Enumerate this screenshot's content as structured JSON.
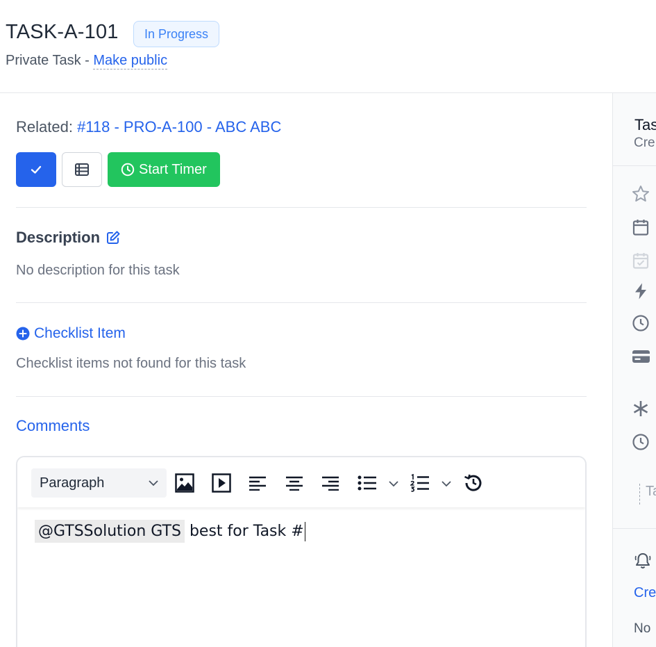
{
  "header": {
    "task_id": "TASK-A-101",
    "status": "In Progress",
    "privacy_label": "Private Task - ",
    "make_public": "Make public"
  },
  "main": {
    "related_label": "Related: ",
    "related_link": "#118 - PRO-A-100 - ABC ABC",
    "actions": {
      "complete_icon": "check-icon",
      "list_icon": "list-icon",
      "timer_icon": "clock-icon",
      "start_timer": "Start Timer"
    },
    "description": {
      "title": "Description",
      "edit_icon": "edit-icon",
      "empty": "No description for this task"
    },
    "checklist": {
      "add_label": "Checklist Item",
      "add_icon": "plus-circle-icon",
      "empty": "Checklist items not found for this task"
    },
    "comments": {
      "title": "Comments",
      "toolbar": {
        "block_format": "Paragraph",
        "icons": [
          "image-icon",
          "media-icon",
          "align-left-icon",
          "align-center-icon",
          "align-right-icon",
          "bullet-list-icon",
          "numbered-list-icon",
          "history-icon"
        ]
      },
      "content": {
        "mention": "@GTSSolution GTS",
        "text": " best for Task #"
      }
    }
  },
  "sidebar": {
    "title": "Tas",
    "subtitle": "Cre",
    "icons": [
      "star-icon",
      "calendar-icon",
      "calendar-check-icon",
      "bolt-icon",
      "clock-icon",
      "credit-card-icon",
      "asterisk-icon",
      "clock-icon",
      "bell-icon"
    ],
    "tag": "Ta",
    "link": "Cre",
    "note": "No"
  },
  "colors": {
    "primary": "#2563eb",
    "success": "#22c55e",
    "status_bg": "#eff6ff",
    "status_border": "#bfdbfe"
  }
}
